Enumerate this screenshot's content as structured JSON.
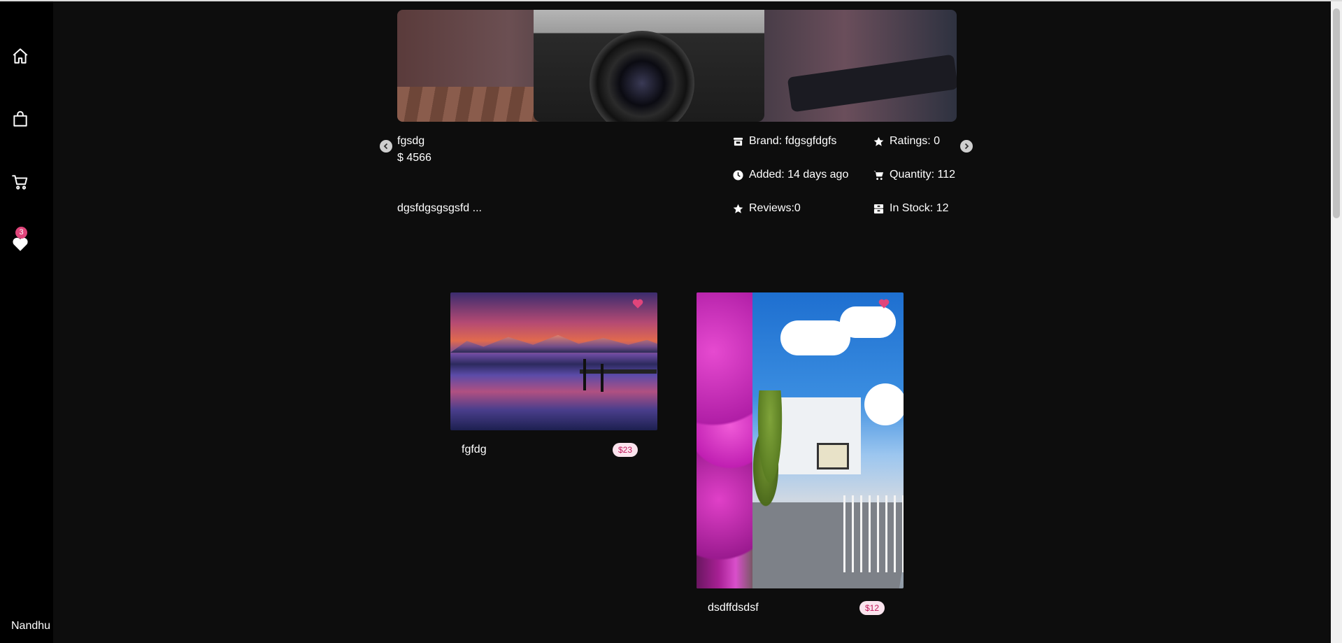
{
  "sidebar": {
    "items": [
      {
        "name": "home",
        "icon": "home-icon"
      },
      {
        "name": "shop",
        "icon": "shopping-bag-icon"
      },
      {
        "name": "cart",
        "icon": "cart-icon"
      },
      {
        "name": "wishlist",
        "icon": "heart-icon",
        "badge": "3"
      }
    ],
    "username": "Nandhu"
  },
  "featured": {
    "title": "fgsdg",
    "price": "$ 4566",
    "description": "dgsfdgsgsgsfd ...",
    "brand": "Brand: fdgsgfdgfs",
    "added": "Added: 14 days ago",
    "reviews": "Reviews:0",
    "ratings": "Ratings: 0",
    "quantity": "Quantity: 112",
    "stock": "In Stock: 12"
  },
  "products": [
    {
      "title": "fgfdg",
      "price": "$23",
      "favorite": true
    },
    {
      "title": "dsdffdsdsf",
      "price": "$12",
      "favorite": true
    }
  ],
  "colors": {
    "accent": "#e0457b",
    "background": "#0d0d0d",
    "sidebar": "#000000",
    "price_badge_bg": "#fbe4ee",
    "price_badge_text": "#c2185b"
  }
}
